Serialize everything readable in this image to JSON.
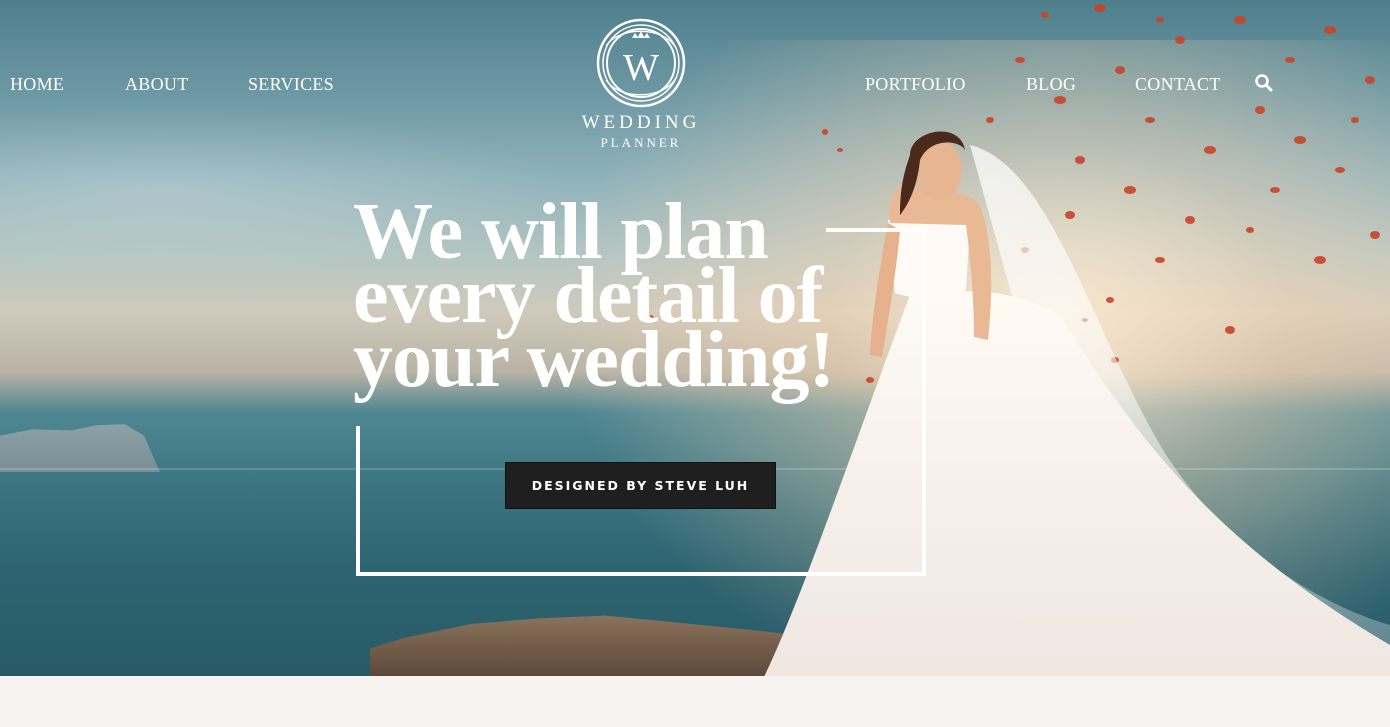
{
  "nav": {
    "left": [
      "HOME",
      "ABOUT",
      "SERVICES"
    ],
    "right": [
      "PORTFOLIO",
      "BLOG",
      "CONTACT"
    ],
    "search_icon": "search-icon"
  },
  "logo": {
    "monogram": "W",
    "line1": "WEDDING",
    "line2": "PLANNER"
  },
  "hero": {
    "headline_line1": "We will plan",
    "headline_line2": "every detail of",
    "headline_line3": "your wedding!",
    "cta_label": "DESIGNED BY STEVE LUH"
  },
  "colors": {
    "text": "#ffffff",
    "cta_bg": "#1f1f1f",
    "page_bg": "#f7f3f1"
  }
}
